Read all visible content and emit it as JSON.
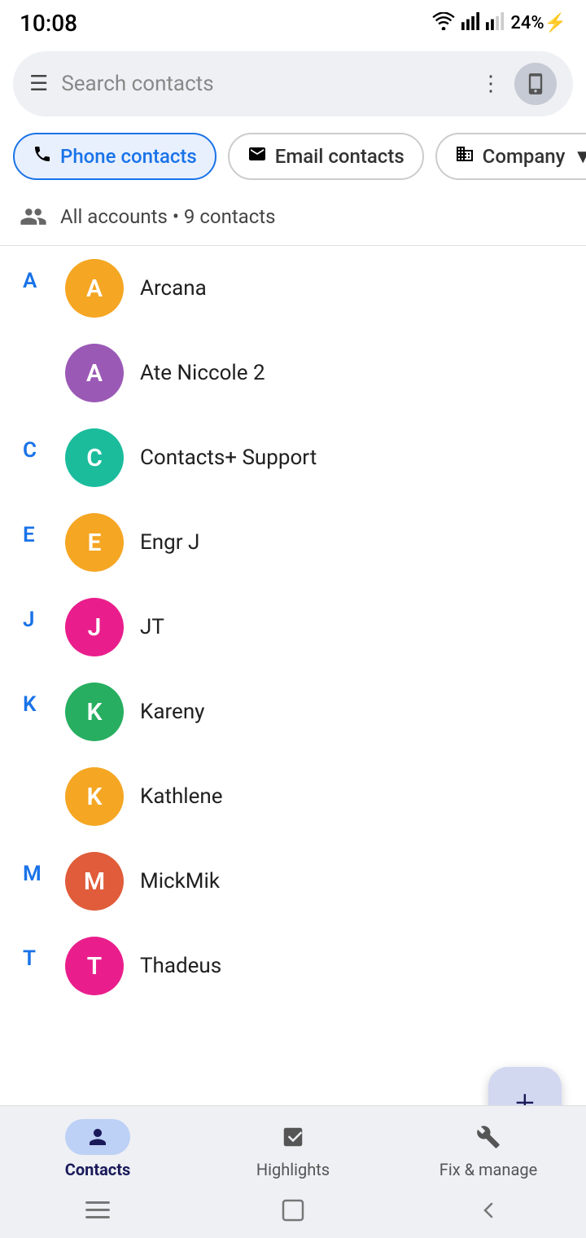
{
  "statusBar": {
    "time": "10:08",
    "battery": "24%",
    "batteryIcon": "⚡"
  },
  "searchBar": {
    "placeholder": "Search contacts",
    "menuIcon": "≡",
    "moreIcon": "⋮"
  },
  "filters": [
    {
      "id": "phone",
      "label": "Phone contacts",
      "active": true,
      "icon": "phone"
    },
    {
      "id": "email",
      "label": "Email contacts",
      "active": false,
      "icon": "email"
    },
    {
      "id": "company",
      "label": "Company",
      "active": false,
      "icon": "company",
      "hasDropdown": true
    }
  ],
  "accountInfo": {
    "text": "All accounts • 9 contacts"
  },
  "contacts": [
    {
      "letter": "A",
      "name": "Arcana",
      "initial": "A",
      "color": "#f5a623",
      "showLetter": true
    },
    {
      "letter": "A",
      "name": "Ate Niccole 2",
      "initial": "A",
      "color": "#9b59b6",
      "showLetter": false
    },
    {
      "letter": "C",
      "name": "Contacts+ Support",
      "initial": "C",
      "color": "#1abc9c",
      "showLetter": true
    },
    {
      "letter": "E",
      "name": "Engr J",
      "initial": "E",
      "color": "#f5a623",
      "showLetter": true
    },
    {
      "letter": "J",
      "name": "JT",
      "initial": "J",
      "color": "#e91e8c",
      "showLetter": true
    },
    {
      "letter": "K",
      "name": "Kareny",
      "initial": "K",
      "color": "#27ae60",
      "showLetter": true
    },
    {
      "letter": "K",
      "name": "Kathlene",
      "initial": "K",
      "color": "#f5a623",
      "showLetter": false
    },
    {
      "letter": "M",
      "name": "MickMik",
      "initial": "M",
      "color": "#e05c3a",
      "showLetter": true
    },
    {
      "letter": "T",
      "name": "Thadeus",
      "initial": "T",
      "color": "#e91e8c",
      "showLetter": true
    }
  ],
  "fab": {
    "label": "+"
  },
  "bottomNav": {
    "items": [
      {
        "id": "contacts",
        "label": "Contacts",
        "active": true
      },
      {
        "id": "highlights",
        "label": "Highlights",
        "active": false
      },
      {
        "id": "fix",
        "label": "Fix & manage",
        "active": false
      }
    ]
  }
}
